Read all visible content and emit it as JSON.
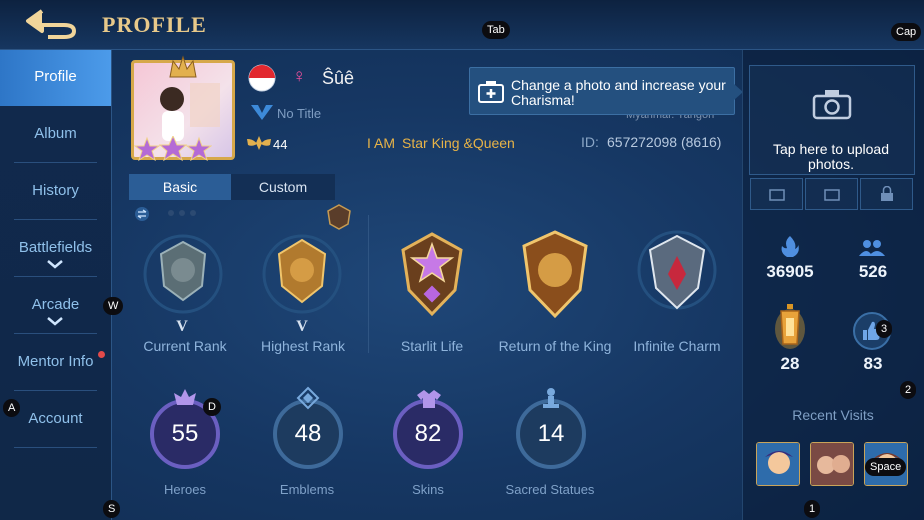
{
  "header": {
    "title": "PROFILE"
  },
  "key_hints": {
    "tab": "Tab",
    "cap": "Cap",
    "w": "W",
    "a": "A",
    "s": "S",
    "d": "D",
    "space": "Space",
    "k1": "1",
    "k2": "2",
    "k3": "3"
  },
  "sidebar": {
    "items": [
      {
        "label": "Profile"
      },
      {
        "label": "Album"
      },
      {
        "label": "History"
      },
      {
        "label": "Battlefields"
      },
      {
        "label": "Arcade"
      },
      {
        "label": "Mentor Info"
      },
      {
        "label": "Account"
      }
    ]
  },
  "profile": {
    "name": "Ŝûê",
    "title": "No Title",
    "level": "44",
    "motto_prefix": "I AM",
    "motto": "Star King &Queen",
    "id_label": "ID:",
    "id_value": "657272098 (8616)",
    "location": "Myanmar. Yangon",
    "gender_symbol": "♀",
    "flag": "Indonesia"
  },
  "tooltip": {
    "text": "Change a photo and increase your Charisma!"
  },
  "tabs": [
    {
      "label": "Basic"
    },
    {
      "label": "Custom"
    }
  ],
  "ranks": [
    {
      "label": "Current Rank",
      "tier": "V"
    },
    {
      "label": "Highest Rank",
      "tier": "V"
    },
    {
      "label": "Starlit Life"
    },
    {
      "label": "Return of the King"
    },
    {
      "label": "Infinite Charm"
    }
  ],
  "stats": [
    {
      "label": "Heroes",
      "value": "55",
      "color": "#a07ee0"
    },
    {
      "label": "Emblems",
      "value": "48",
      "color": "#5e8fc4"
    },
    {
      "label": "Skins",
      "value": "82",
      "color": "#a07ee0"
    },
    {
      "label": "Sacred Statues",
      "value": "14",
      "color": "#5e8fc4"
    }
  ],
  "right_panel": {
    "upload_text": "Tap here to upload photos.",
    "popularity": "36905",
    "followers": "526",
    "charisma": "28",
    "likes": "83",
    "recent_visits_label": "Recent Visits"
  },
  "colors": {
    "accent_gold": "#e8c98a",
    "sidebar_active": "#3d8ad9",
    "motto": "#e7b347"
  }
}
